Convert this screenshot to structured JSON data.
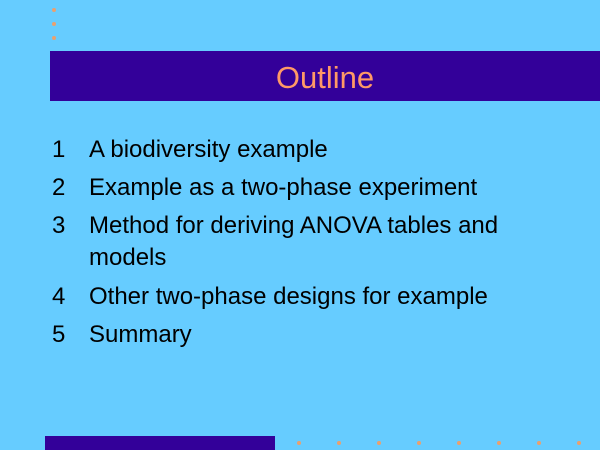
{
  "slide": {
    "title": "Outline",
    "items": [
      {
        "number": "1",
        "text": "A biodiversity example"
      },
      {
        "number": "2",
        "text": "Example as a two-phase experiment"
      },
      {
        "number": "3",
        "text": "Method for deriving ANOVA tables and models"
      },
      {
        "number": "4",
        "text": "Other two-phase designs for example"
      },
      {
        "number": "5",
        "text": "Summary"
      }
    ]
  },
  "colors": {
    "background": "#66CCFF",
    "title_bar": "#330099",
    "title_text": "#FF9966",
    "body_text": "#000000",
    "dots": "#E8A070"
  }
}
